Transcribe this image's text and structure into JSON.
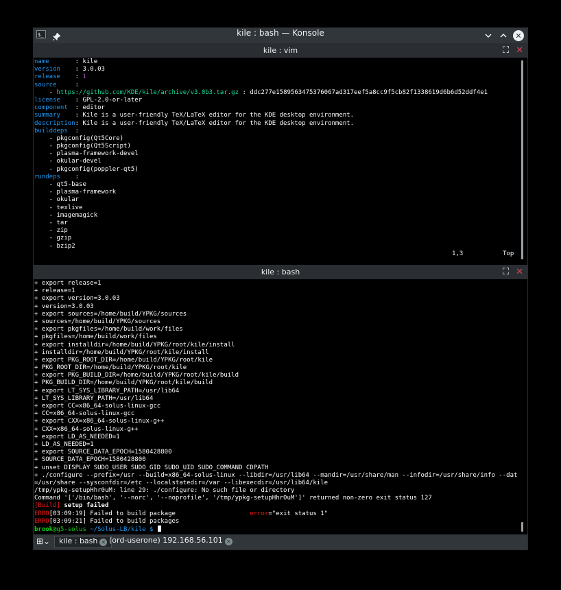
{
  "window": {
    "title": "kile : bash — Konsole"
  },
  "vim_pane": {
    "title": "kile : vim",
    "lines": [
      {
        "k": "name",
        "v": "kile"
      },
      {
        "k": "version",
        "v": "3.0.03"
      },
      {
        "k": "release",
        "v": "1",
        "m": true
      },
      {
        "k": "source",
        "v": ""
      },
      {
        "t": "url",
        "url": "https://github.com/KDE/kile/archive/v3.0b3.tar.gz",
        "hash": "ddc277e1589563475376067ad317eef5a8cc9f5cb82f1338619d6b6d52ddf4e1"
      },
      {
        "k": "license",
        "v": "GPL-2.0-or-later"
      },
      {
        "k": "component",
        "v": "editor"
      },
      {
        "k": "summary",
        "v": "Kile is a user-friendly TeX/LaTeX editor for the KDE desktop environment."
      },
      {
        "k": "description",
        "v": "Kile is a user-friendly TeX/LaTeX editor for the KDE desktop environment.",
        "nopad": true
      },
      {
        "k": "builddeps",
        "v": ""
      },
      {
        "t": "item",
        "v": "pkgconfig(Qt5Core)"
      },
      {
        "t": "item",
        "v": "pkgconfig(Qt5Script)"
      },
      {
        "t": "item",
        "v": "plasma-framework-devel"
      },
      {
        "t": "item",
        "v": "okular-devel"
      },
      {
        "t": "item",
        "v": "pkgconfig(poppler-qt5)"
      },
      {
        "k": "rundeps",
        "v": ""
      },
      {
        "t": "item",
        "v": "qt5-base"
      },
      {
        "t": "item",
        "v": "plasma-framework"
      },
      {
        "t": "item",
        "v": "okular"
      },
      {
        "t": "item",
        "v": "texlive"
      },
      {
        "t": "item",
        "v": "imagemagick"
      },
      {
        "t": "item",
        "v": "tar"
      },
      {
        "t": "item",
        "v": "zip"
      },
      {
        "t": "item",
        "v": "gzip"
      },
      {
        "t": "item",
        "v": "bzip2"
      }
    ],
    "status_position": "1,3",
    "status_scroll": "Top"
  },
  "bash_pane": {
    "title": "kile : bash",
    "lines": [
      "+ export release=1",
      "+ release=1",
      "+ export version=3.0.03",
      "+ version=3.0.03",
      "+ export sources=/home/build/YPKG/sources",
      "+ sources=/home/build/YPKG/sources",
      "+ export pkgfiles=/home/build/work/files",
      "+ pkgfiles=/home/build/work/files",
      "+ export installdir=/home/build/YPKG/root/kile/install",
      "+ installdir=/home/build/YPKG/root/kile/install",
      "+ export PKG_ROOT_DIR=/home/build/YPKG/root/kile",
      "+ PKG_ROOT_DIR=/home/build/YPKG/root/kile",
      "+ export PKG_BUILD_DIR=/home/build/YPKG/root/kile/build",
      "+ PKG_BUILD_DIR=/home/build/YPKG/root/kile/build",
      "+ export LT_SYS_LIBRARY_PATH=/usr/lib64",
      "+ LT_SYS_LIBRARY_PATH=/usr/lib64",
      "+ export CC=x86_64-solus-linux-gcc",
      "+ CC=x86_64-solus-linux-gcc",
      "+ export CXX=x86_64-solus-linux-g++",
      "+ CXX=x86_64-solus-linux-g++",
      "+ export LD_AS_NEEDED=1",
      "+ LD_AS_NEEDED=1",
      "+ export SOURCE_DATA_EPOCH=1580428800",
      "+ SOURCE_DATA_EPOCH=1580428800",
      "+ unset DISPLAY SUDO_USER SUDO_GID SUDO_UID SUDO_COMMAND CDPATH",
      "+ ./configure --prefix=/usr --build=x86_64-solus-linux --libdir=/usr/lib64 --mandir=/usr/share/man --infodir=/usr/share/info --datadir",
      "=/usr/share --sysconfdir=/etc --localstatedir=/var --libexecdir=/usr/lib64/kile",
      "/tmp/ypkg-setupHhr0uM: line 29: ./configure: No such file or directory",
      "Command '['/bin/bash', '--norc', '--noprofile', '/tmp/ypkg-setupHhr0uM']' returned non-zero exit status 127"
    ],
    "build_tag": "[Build]",
    "build_msg": " setup failed",
    "err1_tag": "ERRO",
    "err1_time": "[03:09:19]",
    "err1_msg": " Failed to build package",
    "err1_key": "error",
    "err1_val": "=\"exit status 1\"",
    "err2_tag": "ERRO",
    "err2_time": "[03:09:21]",
    "err2_msg": " Failed to build packages",
    "prompt_user": "brook",
    "prompt_host": "@g5-solus",
    "prompt_path": " ~/Solus-LB/kile",
    "prompt_sym": " $ "
  },
  "tabs": [
    {
      "label": "kile : bash"
    },
    {
      "label": "(ord-userone) 192.168.56.101"
    }
  ],
  "icons": {
    "terminal": "terminal-icon",
    "pin": "pin-icon",
    "minimize": "chevron-down-icon",
    "maximize": "chevron-up-icon",
    "close": "close-icon",
    "pane_maximize": "maximize-pane-icon",
    "pane_close": "close-pane-icon",
    "new_tab": "new-tab-icon"
  },
  "colors": {
    "key": "#1d99f3",
    "url": "#1cdc9a",
    "error": "#ed1515",
    "prompt_user": "#11d116",
    "number": "#9b59b6"
  }
}
